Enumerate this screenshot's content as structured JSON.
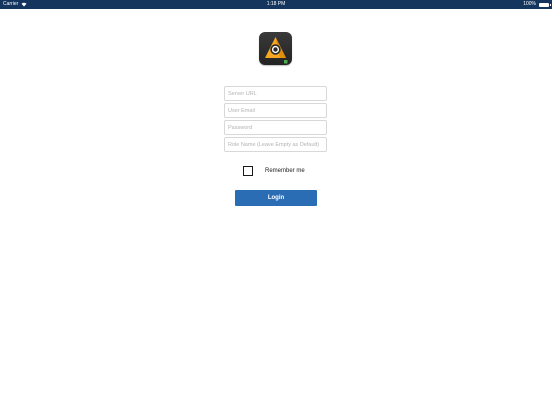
{
  "status_bar": {
    "carrier": "Carrier",
    "wifi_icon": "wifi-icon",
    "time": "1:18 PM",
    "battery_text": "100%",
    "battery_icon": "battery-icon",
    "battery_level": 1.0,
    "background": "#14365e"
  },
  "logo": {
    "icon": "app-logo-icon",
    "accent": "#f5a623",
    "status_dot": "#4cae4c"
  },
  "form": {
    "server_url_placeholder": "Server URL",
    "server_url_value": "",
    "user_email_placeholder": "User Email",
    "user_email_value": "",
    "password_placeholder": "Password",
    "password_value": "",
    "role_name_placeholder": "Role Name (Leave Empty as Default)",
    "role_name_value": "",
    "remember_label": "Remember me",
    "remember_checked": false,
    "login_label": "Login",
    "login_color": "#2b6db5"
  }
}
